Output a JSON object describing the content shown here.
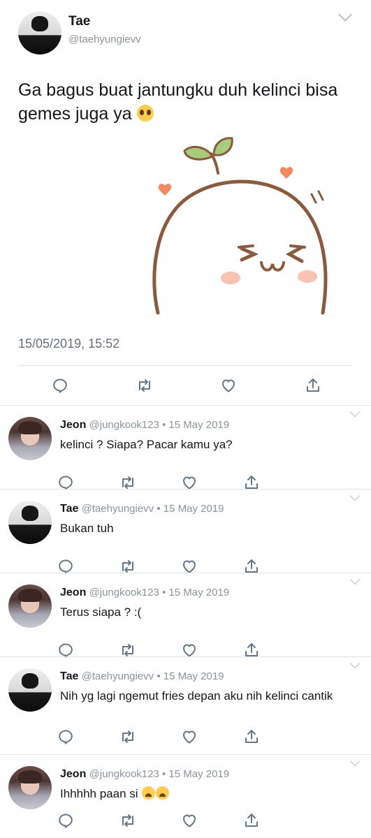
{
  "main_tweet": {
    "author_name": "Tae",
    "author_handle": "@taehyungievv",
    "text": "Ga bagus buat jantungku duh kelinci bisa gemes juga ya",
    "emoji": "pleading-face",
    "image": "sprout-blob-cartoon",
    "timestamp": "15/05/2019, 15:52",
    "actions": [
      "reply-icon",
      "retweet-icon",
      "like-icon",
      "share-icon"
    ]
  },
  "replies": [
    {
      "name": "Jeon",
      "handle": "@jungkook123",
      "date": "• 15 May 2019",
      "text": "kelinci ? Siapa? Pacar kamu ya?",
      "avatar": "jeon"
    },
    {
      "name": "Tae",
      "handle": "@taehyungievv",
      "date": "• 15 May 2019",
      "text": "Bukan tuh",
      "avatar": "tae"
    },
    {
      "name": "Jeon",
      "handle": "@jungkook123",
      "date": "• 15 May 2019",
      "text": "Terus siapa ? :(",
      "avatar": "jeon"
    },
    {
      "name": "Tae",
      "handle": "@taehyungievv",
      "date": "• 15 May 2019",
      "text": "Nih yg lagi ngemut fries depan aku nih kelinci cantik",
      "avatar": "tae"
    },
    {
      "name": "Jeon",
      "handle": "@jungkook123",
      "date": "• 15 May 2019",
      "text": "Ihhhhh paan si",
      "emoji": "weary-face x2",
      "avatar": "jeon"
    }
  ],
  "colors": {
    "text": "#14171a",
    "muted": "#8a949c",
    "divider": "#e1e8ed",
    "icon": "#657786"
  }
}
